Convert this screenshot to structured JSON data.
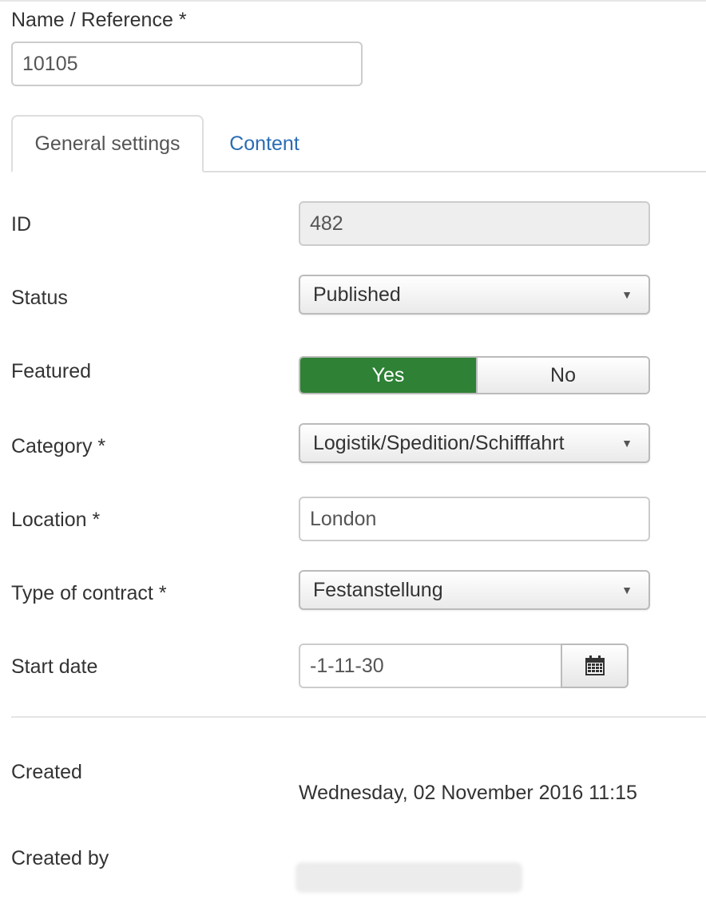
{
  "form": {
    "name_label": "Name / Reference *",
    "name_value": "10105"
  },
  "tabs": [
    {
      "label": "General settings",
      "active": true
    },
    {
      "label": "Content",
      "active": false
    }
  ],
  "fields": {
    "id": {
      "label": "ID",
      "value": "482"
    },
    "status": {
      "label": "Status",
      "value": "Published"
    },
    "featured": {
      "label": "Featured",
      "yes_label": "Yes",
      "no_label": "No",
      "selected": "Yes"
    },
    "category": {
      "label": "Category *",
      "value": "Logistik/Spedition/Schifffahrt"
    },
    "location": {
      "label": "Location *",
      "value": "London"
    },
    "contract": {
      "label": "Type of contract *",
      "value": "Festanstellung"
    },
    "start_date": {
      "label": "Start date",
      "value": "-1-11-30"
    },
    "created": {
      "label": "Created",
      "value": "Wednesday, 02 November 2016 11:15"
    },
    "created_by": {
      "label": "Created by"
    }
  },
  "icons": {
    "dropdown": "caret-down-icon",
    "calendar": "calendar-icon"
  },
  "colors": {
    "featured_yes_bg": "#2e8135",
    "link": "#2a6cb5"
  }
}
